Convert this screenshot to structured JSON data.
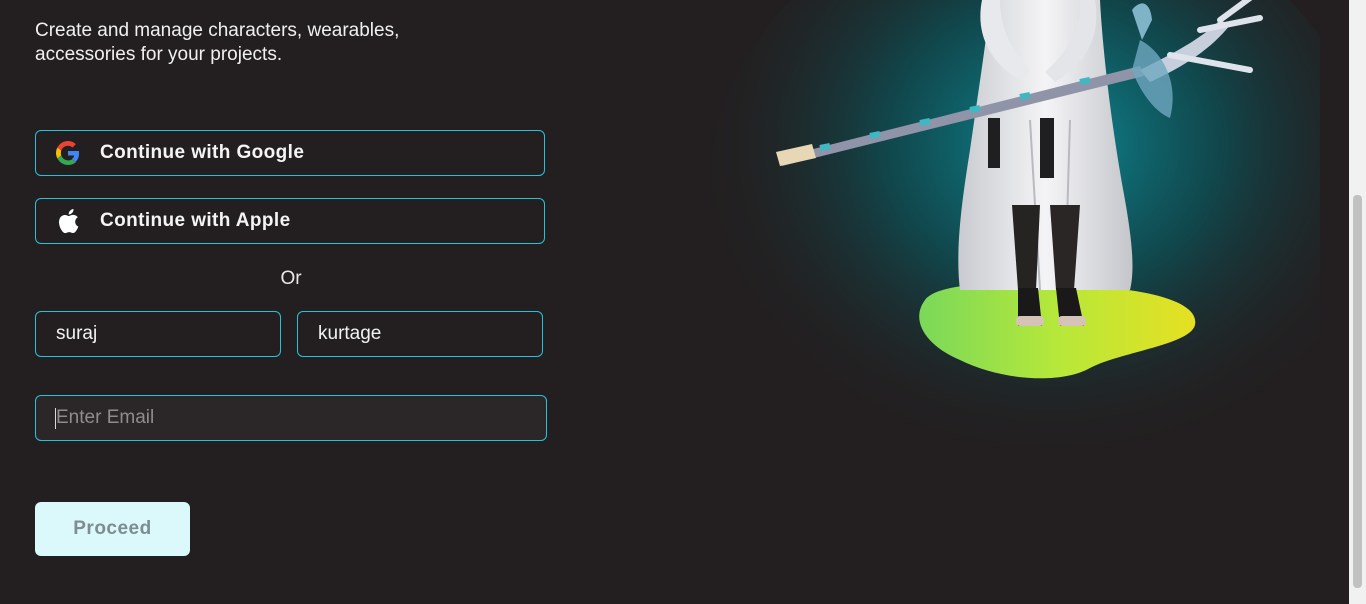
{
  "intro": {
    "line1": "Create and manage characters, wearables,",
    "line2": "accessories for your projects."
  },
  "auth": {
    "google_label": "Continue with Google",
    "apple_label": "Continue with Apple",
    "google_icon": "google-icon",
    "apple_icon": "apple-icon",
    "divider": "Or"
  },
  "form": {
    "first_name_value": "suraj",
    "last_name_value": "kurtage",
    "email_value": "",
    "email_placeholder": "Enter Email",
    "proceed_label": "Proceed"
  },
  "colors": {
    "background": "#231f20",
    "accent_border": "#26c3d8",
    "button_bg": "#dbf8fb"
  }
}
